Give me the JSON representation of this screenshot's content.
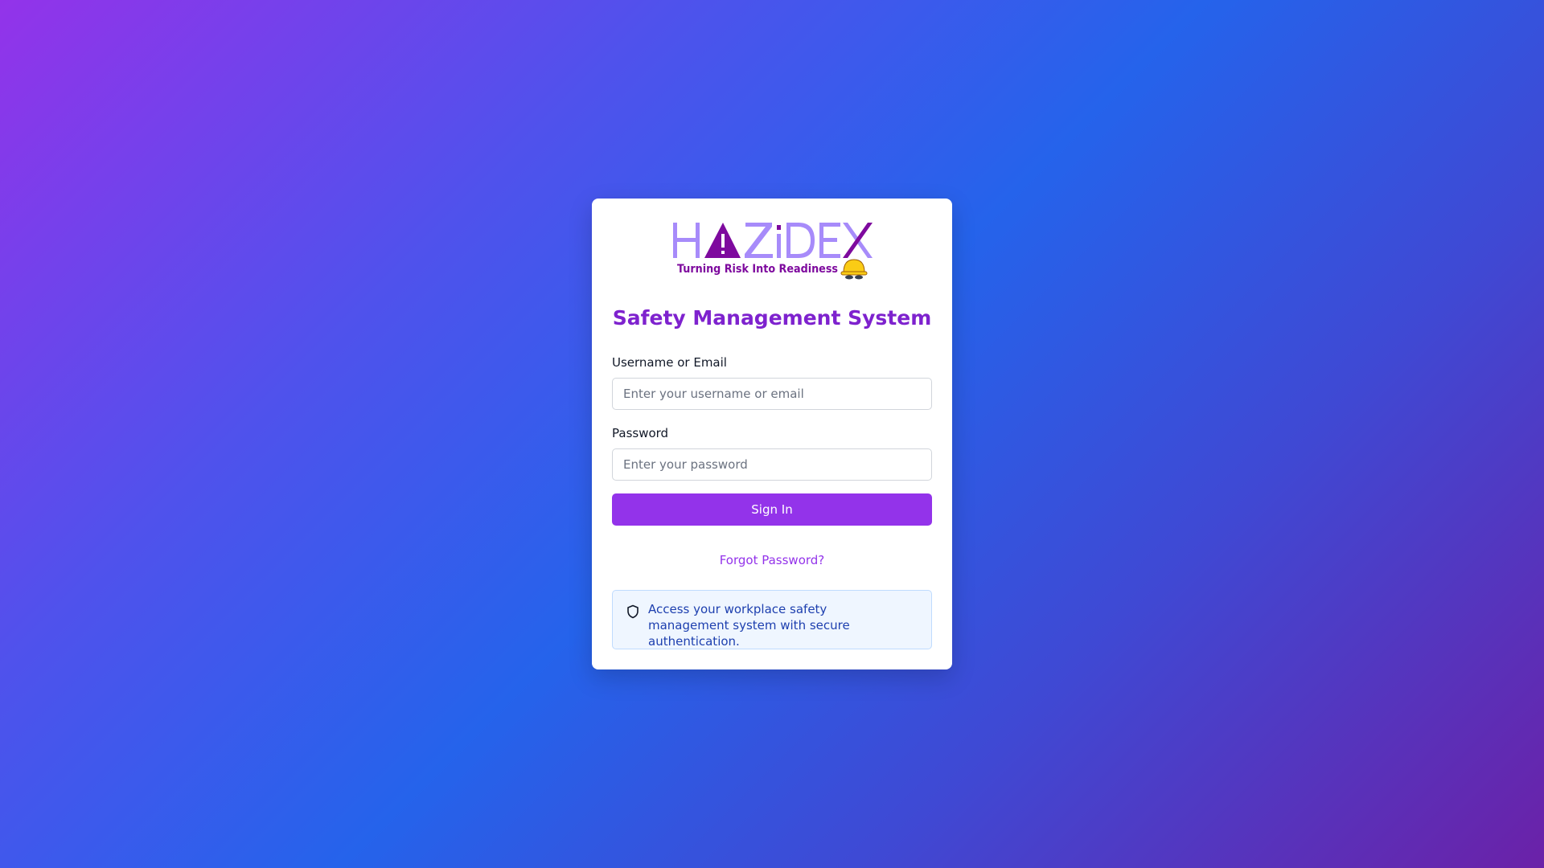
{
  "brand": {
    "name": "HAZIDEX",
    "tagline": "Turning Risk Into Readiness",
    "logo_icon": "hard-hat-icon",
    "warning_icon": "warning-triangle-icon"
  },
  "login": {
    "title": "Safety Management System",
    "username_label": "Username or Email",
    "username_placeholder": "Enter your username or email",
    "username_value": "",
    "password_label": "Password",
    "password_placeholder": "Enter your password",
    "password_value": "",
    "submit_label": "Sign In",
    "forgot_label": "Forgot Password?"
  },
  "info": {
    "icon": "shield-icon",
    "text": "Access your workplace safety management system with secure authentication."
  },
  "colors": {
    "accent": "#9333ea",
    "title": "#7e22ce",
    "logo_light": "#a78bfa",
    "logo_dark": "#7e0a9e",
    "hat": "#facc15",
    "info_bg": "#eff6ff",
    "info_border": "#bfdbfe",
    "info_text": "#1e40af"
  }
}
